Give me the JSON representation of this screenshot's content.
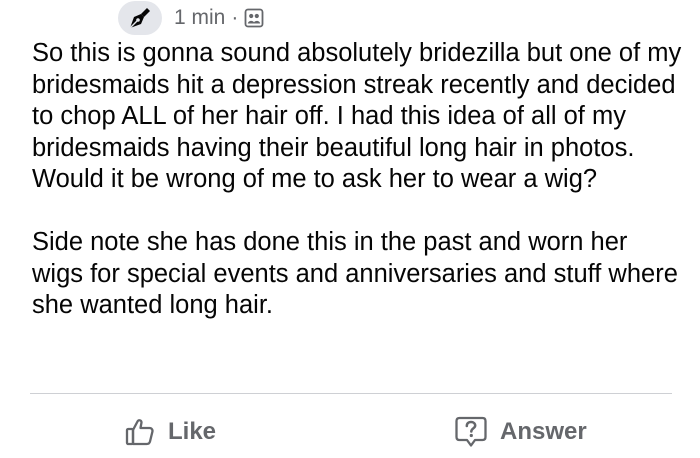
{
  "header": {
    "timestamp": "1 min",
    "separator": "·",
    "badge_icon": "pen-icon",
    "audience_icon": "group-audience-icon"
  },
  "post": {
    "paragraphs": [
      "So this is gonna sound absolutely bridezilla but one of my bridesmaids hit a depression streak recently and decided to chop ALL of her hair off. I had this idea of all of my bridesmaids having their beautiful long hair in photos. Would it be wrong of me to ask her to wear a wig?",
      "Side note she has done this in the past and worn her wigs for special events and anniversaries and stuff where she wanted long hair."
    ]
  },
  "actions": {
    "like_label": "Like",
    "like_icon": "thumbs-up-icon",
    "answer_label": "Answer",
    "answer_icon": "question-bubble-icon"
  },
  "colors": {
    "secondary_text": "#65676b",
    "body_text": "#050505",
    "badge_bg": "#e4e6eb",
    "divider": "#ced0d4"
  }
}
